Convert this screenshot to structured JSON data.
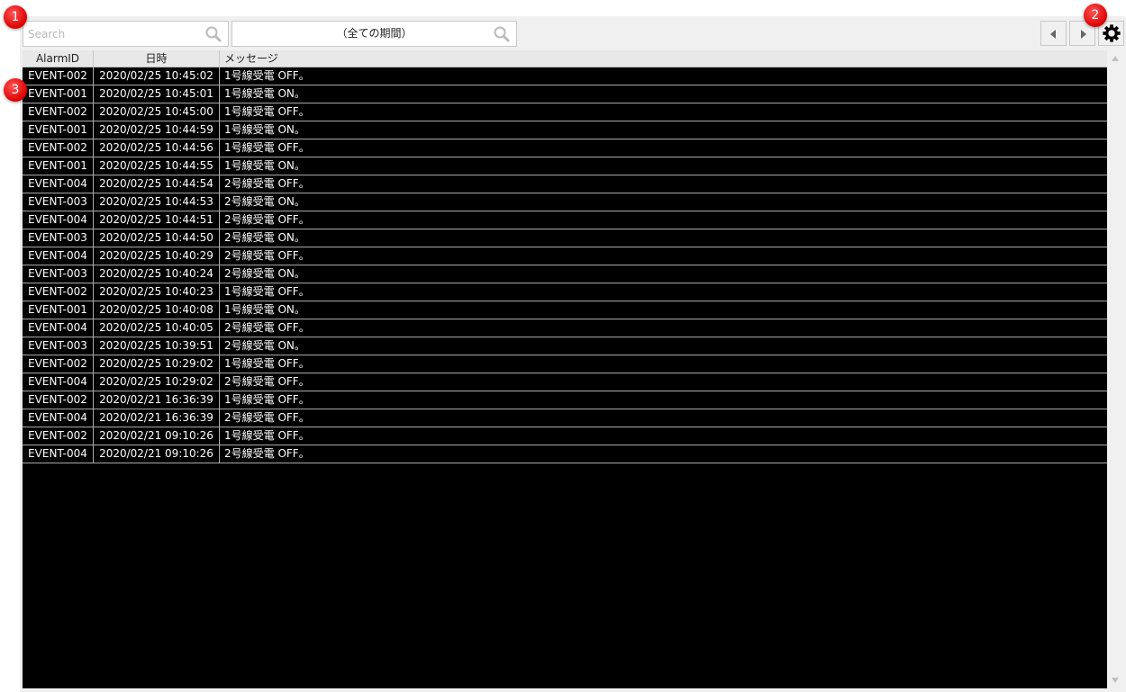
{
  "toolbar": {
    "search_placeholder": "Search",
    "period_label": "（全ての期間）",
    "search_icon": "magnifier-icon",
    "prev_icon": "triangle-left-icon",
    "next_icon": "triangle-right-icon",
    "settings_icon": "gear-icon"
  },
  "badges": [
    "1",
    "2",
    "3"
  ],
  "table": {
    "columns": [
      "AlarmID",
      "日時",
      "メッセージ"
    ],
    "rows": [
      [
        "EVENT-002",
        "2020/02/25 10:45:02",
        "1号線受電 OFF。"
      ],
      [
        "EVENT-001",
        "2020/02/25 10:45:01",
        "1号線受電 ON。"
      ],
      [
        "EVENT-002",
        "2020/02/25 10:45:00",
        "1号線受電 OFF。"
      ],
      [
        "EVENT-001",
        "2020/02/25 10:44:59",
        "1号線受電 ON。"
      ],
      [
        "EVENT-002",
        "2020/02/25 10:44:56",
        "1号線受電 OFF。"
      ],
      [
        "EVENT-001",
        "2020/02/25 10:44:55",
        "1号線受電 ON。"
      ],
      [
        "EVENT-004",
        "2020/02/25 10:44:54",
        "2号線受電 OFF。"
      ],
      [
        "EVENT-003",
        "2020/02/25 10:44:53",
        "2号線受電 ON。"
      ],
      [
        "EVENT-004",
        "2020/02/25 10:44:51",
        "2号線受電 OFF。"
      ],
      [
        "EVENT-003",
        "2020/02/25 10:44:50",
        "2号線受電 ON。"
      ],
      [
        "EVENT-004",
        "2020/02/25 10:40:29",
        "2号線受電 OFF。"
      ],
      [
        "EVENT-003",
        "2020/02/25 10:40:24",
        "2号線受電 ON。"
      ],
      [
        "EVENT-002",
        "2020/02/25 10:40:23",
        "1号線受電 OFF。"
      ],
      [
        "EVENT-001",
        "2020/02/25 10:40:08",
        "1号線受電 ON。"
      ],
      [
        "EVENT-004",
        "2020/02/25 10:40:05",
        "2号線受電 OFF。"
      ],
      [
        "EVENT-003",
        "2020/02/25 10:39:51",
        "2号線受電 ON。"
      ],
      [
        "EVENT-002",
        "2020/02/25 10:29:02",
        "1号線受電 OFF。"
      ],
      [
        "EVENT-004",
        "2020/02/25 10:29:02",
        "2号線受電 OFF。"
      ],
      [
        "EVENT-002",
        "2020/02/21 16:36:39",
        "1号線受電 OFF。"
      ],
      [
        "EVENT-004",
        "2020/02/21 16:36:39",
        "2号線受電 OFF。"
      ],
      [
        "EVENT-002",
        "2020/02/21 09:10:26",
        "1号線受電 OFF。"
      ],
      [
        "EVENT-004",
        "2020/02/21 09:10:26",
        "2号線受電 OFF。"
      ]
    ]
  },
  "colors": {
    "badge": "#e01010",
    "grid_bg": "#000000",
    "panel_bg": "#f0f0f0"
  }
}
